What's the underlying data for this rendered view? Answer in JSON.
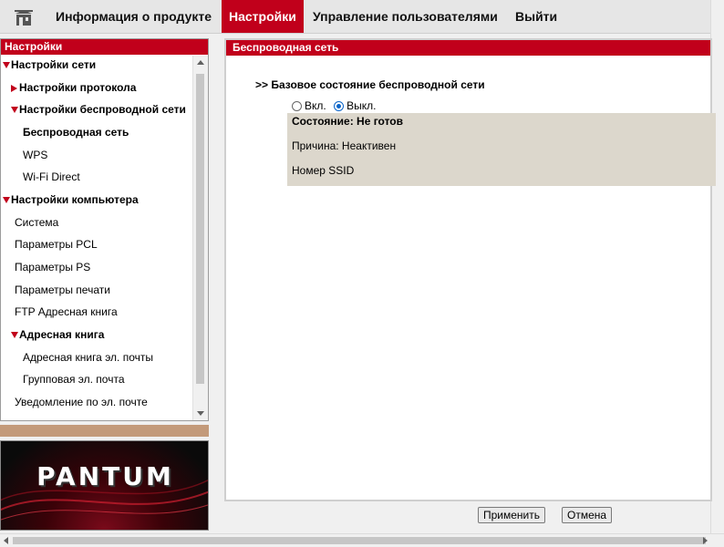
{
  "nav": {
    "home_icon": "home-icon",
    "items": [
      {
        "label": "Информация о продукте"
      },
      {
        "label": "Настройки"
      },
      {
        "label": "Управление пользователями"
      },
      {
        "label": "Выйти"
      }
    ],
    "active_index": 1
  },
  "sidebar": {
    "title": "Настройки",
    "items": [
      {
        "label": "Настройки сети"
      },
      {
        "label": "Настройки протокола"
      },
      {
        "label": "Настройки беспроводной сети"
      },
      {
        "label": "Беспроводная сеть"
      },
      {
        "label": "WPS"
      },
      {
        "label": "Wi-Fi Direct"
      },
      {
        "label": "Настройки компьютера"
      },
      {
        "label": "Система"
      },
      {
        "label": "Параметры PCL"
      },
      {
        "label": "Параметры PS"
      },
      {
        "label": "Параметры печати"
      },
      {
        "label": "FTP Адресная книга"
      },
      {
        "label": "Адресная книга"
      },
      {
        "label": "Адресная книга эл. почты"
      },
      {
        "label": "Групповая эл. почта"
      },
      {
        "label": "Уведомление по эл. почте"
      }
    ]
  },
  "logo": {
    "text": "PANTUM"
  },
  "main": {
    "title": "Беспроводная сеть",
    "section_title": ">> Базовое состояние беспроводной сети",
    "radio_on_label": "Вкл.",
    "radio_off_label": "Выкл.",
    "selected": "off",
    "status_label": "Состояние: Не готов",
    "reason_label": "Причина: Неактивен",
    "ssid_label": "Номер SSID"
  },
  "buttons": {
    "apply": "Применить",
    "cancel": "Отмена"
  },
  "colors": {
    "accent": "#c1001b",
    "status_bg": "#dcd7cc",
    "radio_selected": "#0a64c8"
  }
}
